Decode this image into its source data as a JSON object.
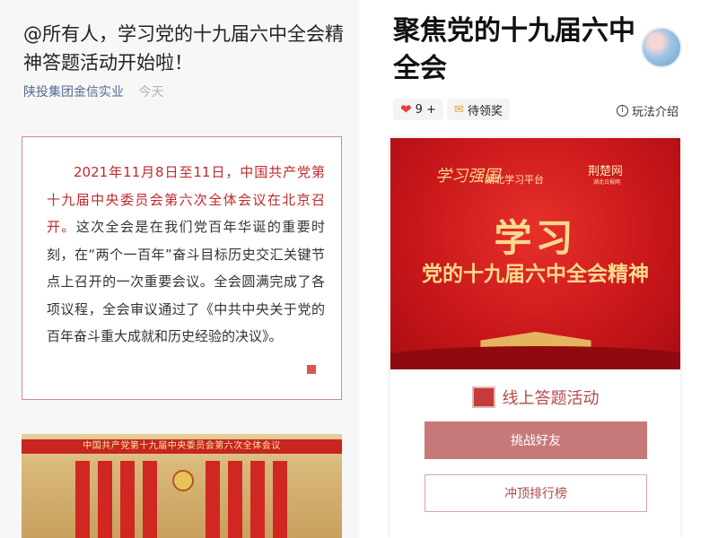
{
  "left": {
    "title": "@所有人，学习党的十九届六中全会精神答题活动开始啦！",
    "org": "陕投集团金信实业",
    "date": "今天",
    "quote_red": "2021年11月8日至11日，中国共产党第十九届中央委员会第六次全体会议在北京召开。",
    "quote_rest": "这次全会是在我们党百年华诞的重要时刻，在“两个一百年”奋斗目标历史交汇关键节点上召开的一次重要会议。全会圆满完成了各项议程，全会审议通过了《中共中央关于党的百年奋斗重大成就和历史经验的决议》。",
    "hall_banner": "中国共产党第十九届中央委员会第六次全体会议"
  },
  "right": {
    "title": "聚焦党的十九届六中全会",
    "likes": "9 +",
    "award_label": "待领奖",
    "rules_label": "玩法介绍",
    "banner": {
      "logo_left": "学习强国",
      "logo_left_sub": "湖北学习平台",
      "logo_right": "荆楚网",
      "logo_right_sub": "湖北日报网",
      "title": "学习",
      "subtitle": "党的十九届六中全会精神"
    },
    "activity_label": "线上答题活动",
    "challenge_button": "挑战好友",
    "ranking_button": "冲顶排行榜"
  },
  "colors": {
    "accent_red": "#c0282d",
    "button_fill": "#c7797a",
    "link_blue": "#576b95"
  },
  "icons": [
    "heart-icon",
    "envelope-icon",
    "info-icon",
    "activity-icon"
  ]
}
